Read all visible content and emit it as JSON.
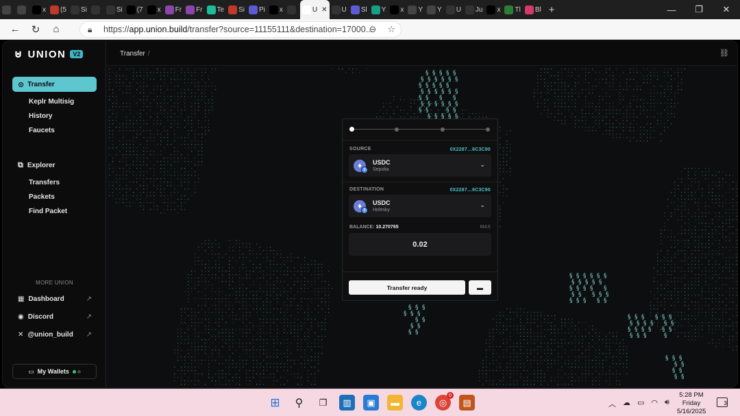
{
  "browser": {
    "tabs": [
      {
        "label": "",
        "icon": "tab-actions-icon",
        "color": "#444"
      },
      {
        "label": "",
        "icon": "tabs-icon",
        "color": "#444"
      },
      {
        "label": "x",
        "icon": "x-icon",
        "color": "#000"
      },
      {
        "label": "(5",
        "icon": "site-icon",
        "color": "#c0392b"
      },
      {
        "label": "Si",
        "icon": "site-icon",
        "color": "#333"
      },
      {
        "label": "",
        "icon": "site-icon",
        "color": "#333"
      },
      {
        "label": "Si",
        "icon": "site-icon",
        "color": "#333"
      },
      {
        "label": "(7",
        "icon": "x-icon",
        "color": "#000"
      },
      {
        "label": "x",
        "icon": "x-icon",
        "color": "#000"
      },
      {
        "label": "Fr",
        "icon": "site-icon",
        "color": "#8e44ad"
      },
      {
        "label": "Fr",
        "icon": "site-icon",
        "color": "#8e44ad"
      },
      {
        "label": "Te",
        "icon": "site-icon",
        "color": "#1abc9c"
      },
      {
        "label": "Si",
        "icon": "site-icon",
        "color": "#c0392b"
      },
      {
        "label": "Pi",
        "icon": "site-icon",
        "color": "#5b5bd6"
      },
      {
        "label": "x",
        "icon": "x-icon",
        "color": "#000"
      },
      {
        "label": "",
        "icon": "union-icon",
        "color": "#333"
      },
      {
        "label": "U",
        "icon": "union-icon",
        "color": "#fff",
        "active": true
      },
      {
        "label": "U",
        "icon": "union-icon",
        "color": "#333"
      },
      {
        "label": "Sl",
        "icon": "site-icon",
        "color": "#5b5bd6"
      },
      {
        "label": "Y",
        "icon": "site-icon",
        "color": "#16a085"
      },
      {
        "label": "x",
        "icon": "x-icon",
        "color": "#000"
      },
      {
        "label": "Y",
        "icon": "site-icon",
        "color": "#444"
      },
      {
        "label": "Y",
        "icon": "site-icon",
        "color": "#444"
      },
      {
        "label": "U",
        "icon": "union-icon",
        "color": "#333"
      },
      {
        "label": "Ju",
        "icon": "union-icon",
        "color": "#333"
      },
      {
        "label": "x",
        "icon": "x-icon",
        "color": "#000"
      },
      {
        "label": "Tl",
        "icon": "site-icon",
        "color": "#2e7d32"
      },
      {
        "label": "Bl",
        "icon": "site-icon",
        "color": "#d63a6a"
      }
    ],
    "new_tab": "+",
    "url_prefix": "https://",
    "url_host": "app.union.build",
    "url_rest": "/transfer?source=11155111&destination=17000...",
    "extensions": [
      {
        "icon": "metamask-icon",
        "color": "#e2761b",
        "glyph": "◆"
      },
      {
        "icon": "extension-icon",
        "color": "#4a5fd6",
        "glyph": "●"
      },
      {
        "icon": "extension-icon",
        "color": "#7d6cf2",
        "glyph": "●"
      },
      {
        "icon": "extension-icon",
        "color": "#d9413b",
        "glyph": "■"
      },
      {
        "icon": "extension-icon",
        "color": "#111",
        "glyph": "●"
      },
      {
        "icon": "extension-icon",
        "color": "#8bc34a",
        "glyph": "▲"
      },
      {
        "icon": "extension-icon",
        "color": "#2f80ed",
        "glyph": "K"
      },
      {
        "icon": "extension-icon",
        "color": "#1cb36b",
        "glyph": "●"
      },
      {
        "icon": "extension-icon",
        "color": "#2ecc40",
        "glyph": "✕"
      },
      {
        "icon": "puzzle-icon",
        "color": "#666",
        "glyph": "✚"
      },
      {
        "icon": "download-icon",
        "color": "#666",
        "glyph": "↓"
      },
      {
        "icon": "profile-icon",
        "color": "#a04545",
        "glyph": "●"
      },
      {
        "icon": "more-icon",
        "color": "#666",
        "glyph": "⋯"
      },
      {
        "icon": "copilot-icon",
        "color": "#6e5df2",
        "glyph": "●"
      }
    ]
  },
  "app": {
    "logo_text": "UNION",
    "version_badge": "V2",
    "sidebar": {
      "active_item": "Transfer",
      "transfer_subitems": [
        "Keplr Multisig",
        "History",
        "Faucets"
      ],
      "explorer_label": "Explorer",
      "explorer_subitems": [
        "Transfers",
        "Packets",
        "Find Packet"
      ],
      "more_heading": "MORE UNION",
      "links": [
        "Dashboard",
        "Discord",
        "@union_build"
      ],
      "wallets_label": "My Wallets"
    },
    "breadcrumb": "Transfer",
    "breadcrumb_sep": "/",
    "card": {
      "source_label": "SOURCE",
      "source_address": "0X2287…6C3C90",
      "source_token": "USDC",
      "source_chain": "Sepolia",
      "destination_label": "DESTINATION",
      "destination_address": "0X2287…6C3C90",
      "destination_token": "USDC",
      "destination_chain": "Holesky",
      "balance_label": "BALANCE:",
      "balance_value": "10.270765",
      "max_label": "MAX",
      "amount": "0.02",
      "transfer_button": "Transfer ready"
    },
    "accent_color": "#5ec6cf"
  },
  "taskbar": {
    "time": "5:28 PM",
    "day": "Friday",
    "date": "5/16/2025",
    "chrome_badge": "0",
    "notification_count": "3"
  }
}
